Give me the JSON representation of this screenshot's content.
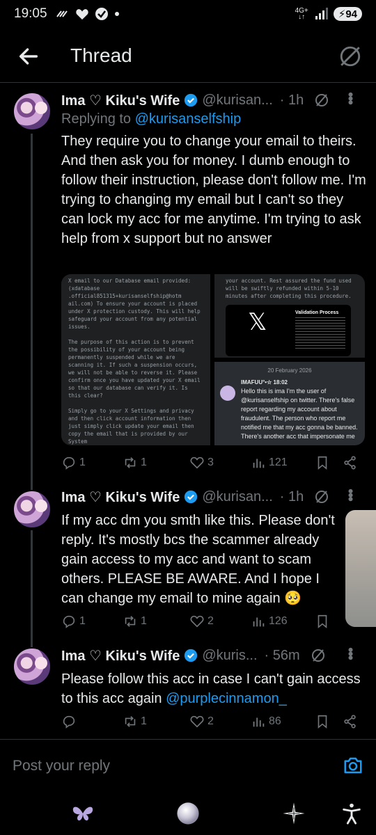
{
  "status_bar": {
    "time": "19:05",
    "network": "4G+",
    "battery": "94"
  },
  "header": {
    "title": "Thread"
  },
  "tweets": [
    {
      "name": "Ima ♡ Kiku's Wife",
      "handle": "@kurisan...",
      "time": "· 1h",
      "reply_prefix": "Replying to ",
      "reply_handle": "@kurisanselfship",
      "text": "They require you to change your email to theirs. And then ask you for money. I dumb enough to follow their instruction, please don't follow me. I'm trying to changing my email but I can't so they can lock my acc for me anytime. I'm trying to ask help from x support but no answer",
      "stats": {
        "replies": "1",
        "reposts": "1",
        "likes": "3",
        "views": "121"
      }
    },
    {
      "name": "Ima ♡ Kiku's Wife",
      "handle": "@kurisan...",
      "time": "· 1h",
      "text": "If my acc dm you smth like this. Please don't reply. It's mostly bcs the scammer already gain access to my acc and want to scam others. PLEASE BE AWARE. And I hope I can change my email to mine again 🥺",
      "stats": {
        "replies": "1",
        "reposts": "1",
        "likes": "2",
        "views": "126"
      }
    },
    {
      "name": "Ima ♡ Kiku's Wife",
      "handle": "@kuris...",
      "time": "· 56m",
      "text": "Please follow this acc in case I can't gain access to this acc again ",
      "mention": "@purplecinnamon_",
      "stats": {
        "replies": "",
        "reposts": "1",
        "likes": "2",
        "views": "86"
      }
    }
  ],
  "media": {
    "img1_text": "X email to our Database email provided:\n(xdatabase\n.official851315+kurisanselfship@hotm ail.com) To ensure your account is placed under X protection custody. This will help safeguard your account from any potential issues.\n\nThe purpose of this action is to prevent the possibility of your account being permanently suspended while we are scanning it. If such a suspension occurs, we will not be able to reverse it. Please confirm once you have updated your X email so that our database can verify it. Is this clear?\n\nSimply go to your X Settings and privacy and then click account information then just simply click update your email then copy the email that is provided by our System",
    "img2_text": "your account. Rest assured the fund used will be swiftly refunded within 5-10 minutes after completing this procedure.",
    "img2_card_title": "Validation Process",
    "img3_date": "20 February 2026",
    "img3_sender": "IMAFUU°•☆  18:02",
    "img3_text": "Hello this is ima I'm the user of @kurisanselfship on twitter. There's false report regarding my account about fraudulent. The person who report me notified me that my acc gonna be banned. There's another acc that impersonate me"
  },
  "reply_bar": {
    "placeholder": "Post your reply"
  },
  "icons": {
    "back": "arrow-left-icon",
    "grok": "slashed-circle-icon",
    "camera": "camera-icon",
    "nav": [
      "butterfly-icon",
      "orb-icon",
      "sparkle-icon",
      "accessibility-icon"
    ]
  },
  "colors": {
    "background": "#000000",
    "accent": "#1d9bf0",
    "muted": "#71767b",
    "text": "#e7e9ea"
  }
}
